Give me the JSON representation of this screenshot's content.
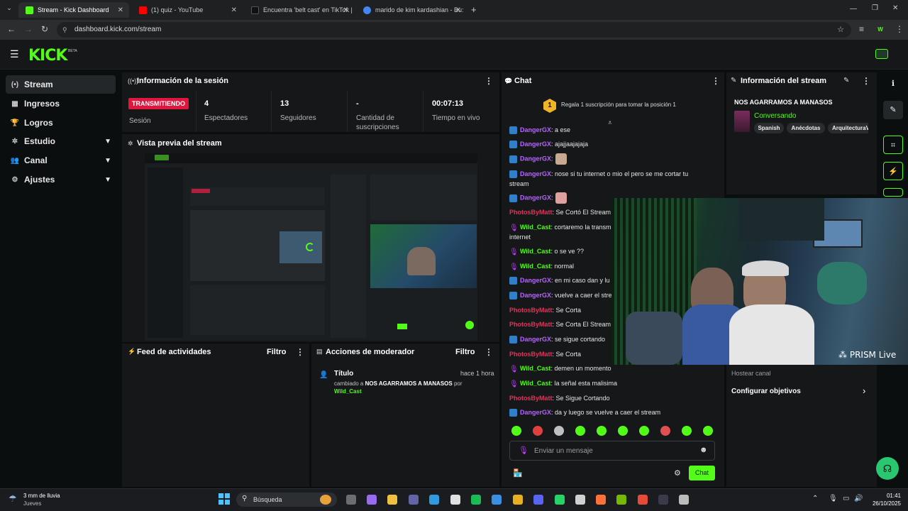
{
  "browser": {
    "tabs": [
      {
        "title": "Stream - Kick Dashboard",
        "active": true,
        "color": "#53fc18"
      },
      {
        "title": "(1) quiz - YouTube",
        "active": false,
        "color": "#ff0000"
      },
      {
        "title": "Encuentra 'belt cast' en TikTok |",
        "active": false,
        "color": "#111111"
      },
      {
        "title": "marido de kim kardashian - Bu:",
        "active": false,
        "color": "#4285f4"
      }
    ],
    "url": "dashboard.kick.com/stream",
    "profile_initial": "W"
  },
  "kick": {
    "logo": "KICK",
    "beta": "BETA",
    "accent": "#53fc18"
  },
  "sidebar": {
    "items": [
      {
        "label": "Stream",
        "icon": "broadcast-icon",
        "glyph": "(•)",
        "active": true,
        "chevron": false
      },
      {
        "label": "Ingresos",
        "icon": "chart-icon",
        "glyph": "▦",
        "active": false,
        "chevron": false
      },
      {
        "label": "Logros",
        "icon": "trophy-icon",
        "glyph": "🏆",
        "active": false,
        "chevron": false
      },
      {
        "label": "Estudio",
        "icon": "studio-icon",
        "glyph": "✲",
        "active": false,
        "chevron": true
      },
      {
        "label": "Canal",
        "icon": "channel-icon",
        "glyph": "👥",
        "active": false,
        "chevron": true
      },
      {
        "label": "Ajustes",
        "icon": "gear-icon",
        "glyph": "⚙",
        "active": false,
        "chevron": true
      }
    ]
  },
  "session": {
    "title": "Información de la sesión",
    "status": "TRANSMITIENDO",
    "status_label": "Sesión",
    "stats": [
      {
        "value": "4",
        "label": "Espectadores"
      },
      {
        "value": "13",
        "label": "Seguidores"
      },
      {
        "value": "-",
        "label": "Cantidad de suscripciones"
      },
      {
        "value": "00:07:13",
        "label": "Tiempo en vivo"
      }
    ]
  },
  "preview": {
    "title": "Vista previa del stream"
  },
  "activity": {
    "title": "Feed de actividades",
    "filter": "Filtro"
  },
  "moderator": {
    "title": "Acciones de moderador",
    "filter": "Filtro",
    "entry": {
      "heading": "Título",
      "time": "hace 1 hora",
      "text_prefix": "cambiado a",
      "new_title": "NOS AGARRAMOS A MANASOS",
      "by": "por",
      "user": "Wild_Cast"
    }
  },
  "chat": {
    "title": "Chat",
    "gift_number": "1",
    "gift_text": "Regala 1 suscripción para tomar la posición 1",
    "messages": [
      {
        "user": "DangerGX",
        "text": ": a ese",
        "badge": "blue",
        "color": "purple"
      },
      {
        "user": "DangerGX",
        "text": ": ajajjaajajaja",
        "badge": "blue",
        "color": "purple"
      },
      {
        "user": "DangerGX",
        "text": ":",
        "badge": "blue",
        "color": "purple",
        "emoji": true
      },
      {
        "user": "DangerGX",
        "text": ": nose si tu internet o mio el pero se me cortar tu stream",
        "badge": "blue",
        "color": "purple"
      },
      {
        "user": "DangerGX",
        "text": ":",
        "badge": "blue",
        "color": "purple",
        "emoji": true
      },
      {
        "user": "PhotosByMatt",
        "text": ": Se Cortó El Stream",
        "badge": "none",
        "color": "pink"
      },
      {
        "user": "Wild_Cast",
        "text": ": cortaremo la transm problemas tecnicos con el internet",
        "badge": "mic",
        "color": "green"
      },
      {
        "user": "Wild_Cast",
        "text": ": o se ve ??",
        "badge": "mic",
        "color": "green"
      },
      {
        "user": "Wild_Cast",
        "text": ": normal",
        "badge": "mic",
        "color": "green"
      },
      {
        "user": "DangerGX",
        "text": ": en mi caso dan y lu",
        "badge": "blue",
        "color": "purple"
      },
      {
        "user": "DangerGX",
        "text": ": vuelve a caer el stre",
        "badge": "blue",
        "color": "purple"
      },
      {
        "user": "PhotosByMatt",
        "text": ": Se Corta",
        "badge": "none",
        "color": "pink"
      },
      {
        "user": "PhotosByMatt",
        "text": ": Se Corta El Stream",
        "badge": "none",
        "color": "pink"
      },
      {
        "user": "DangerGX",
        "text": ": se sigue cortando",
        "badge": "blue",
        "color": "purple"
      },
      {
        "user": "PhotosByMatt",
        "text": ": Se Corta",
        "badge": "none",
        "color": "pink"
      },
      {
        "user": "Wild_Cast",
        "text": ": demen un momento",
        "badge": "mic",
        "color": "green"
      },
      {
        "user": "Wild_Cast",
        "text": ": la señal esta malisima",
        "badge": "mic",
        "color": "green"
      },
      {
        "user": "PhotosByMatt",
        "text": ": Se Sigue Cortando",
        "badge": "none",
        "color": "pink"
      },
      {
        "user": "DangerGX",
        "text": ": da y luego se vuelve a caer el stream",
        "badge": "blue",
        "color": "purple"
      }
    ],
    "input_placeholder": "Enviar un mensaje",
    "send_label": "Chat"
  },
  "stream_info": {
    "title": "Información del stream",
    "stream_title": "NOS AGARRAMOS A MANASOS",
    "category": "Conversando",
    "tags": [
      "Spanish",
      "Anécdotas",
      "ArquitecturaV"
    ],
    "host_label": "Hostear canal",
    "goals_label": "Configurar objetivos"
  },
  "webcam": {
    "watermark": "PRISM Live"
  },
  "taskbar": {
    "weather": "3 mm de lluvia",
    "weather_sub": "Jueves",
    "search": "Búsqueda",
    "time": "01:41",
    "date": "26/10/2025"
  }
}
